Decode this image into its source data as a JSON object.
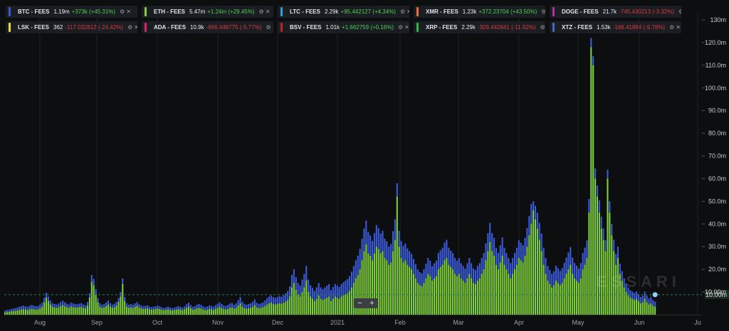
{
  "legend": [
    {
      "name": "BTC - FEES",
      "value": "1.19m",
      "change": "+373k",
      "pct": "(+45.31%)",
      "dir": "up",
      "color": "#3b5bdb"
    },
    {
      "name": "ETH - FEES",
      "value": "5.47m",
      "change": "+1.24m",
      "pct": "(+29.45%)",
      "dir": "up",
      "color": "#7fd13b"
    },
    {
      "name": "LTC - FEES",
      "value": "2.29k",
      "change": "+95.442127",
      "pct": "(+4.34%)",
      "dir": "up",
      "color": "#2aa1d9"
    },
    {
      "name": "XMR - FEES",
      "value": "1.23k",
      "change": "+372.23704",
      "pct": "(+43.50%)",
      "dir": "up",
      "color": "#e8703a"
    },
    {
      "name": "DOGE - FEES",
      "value": "21.7k",
      "change": "-745.430213",
      "pct": "(-3.32%)",
      "dir": "down",
      "color": "#b0309c"
    },
    {
      "name": "LSK - FEES",
      "value": "362",
      "change": "-117.032812",
      "pct": "(-24.42%)",
      "dir": "down",
      "color": "#e8e02a"
    },
    {
      "name": "ADA - FEES",
      "value": "10.9k",
      "change": "-666.448775",
      "pct": "(-5.77%)",
      "dir": "down",
      "color": "#d8286c"
    },
    {
      "name": "BSV - FEES",
      "value": "1.01k",
      "change": "+1.662759",
      "pct": "(+0.16%)",
      "dir": "up",
      "color": "#c4202c"
    },
    {
      "name": "XRP - FEES",
      "value": "2.29k",
      "change": "-309.442841",
      "pct": "(-11.92%)",
      "dir": "down",
      "color": "#2fb84a"
    },
    {
      "name": "XTZ - FEES",
      "value": "1.53k",
      "change": "-166.41894",
      "pct": "(-9.78%)",
      "dir": "down",
      "color": "#4a64c8"
    }
  ],
  "legend_icons": [
    "gear-icon",
    "close-icon"
  ],
  "zoom": {
    "minus": "−",
    "plus": "+"
  },
  "watermark": "ESSARI",
  "colors": {
    "background": "#0c0e10",
    "eth": "#7fd13b",
    "btc": "#3b5bdb",
    "grid": "#1c2026",
    "ref_line": "#2e7d5a",
    "marker": "#8fd3f0"
  },
  "chart_data": {
    "type": "bar",
    "stacked": true,
    "x_start": "Jul 2020",
    "x_ticks": [
      "Aug",
      "Sep",
      "Oct",
      "Nov",
      "Dec",
      "2021",
      "Feb",
      "Mar",
      "Apr",
      "May",
      "Jun",
      "Ju"
    ],
    "y_ticks": [
      "10.00m",
      "20.0m",
      "30.0m",
      "40.0m",
      "50.0m",
      "60.0m",
      "70.0m",
      "80.0m",
      "90.0m",
      "100.0m",
      "110.0m",
      "120.0m",
      "130m"
    ],
    "ylim": [
      0,
      130
    ],
    "y_unit": "m",
    "reference_line": 8.8,
    "reference_label": "10.00m",
    "series": [
      {
        "name": "ETH - FEES",
        "color": "#7fd13b",
        "values": [
          1.0,
          1.2,
          1.3,
          1.5,
          1.6,
          1.7,
          1.9,
          2.1,
          2.3,
          2.4,
          2.2,
          2.0,
          2.4,
          2.6,
          2.4,
          2.2,
          2.3,
          2.8,
          3.5,
          5.5,
          7.5,
          6.0,
          4.5,
          3.5,
          3.2,
          3.0,
          3.3,
          3.8,
          4.2,
          3.7,
          3.3,
          3.0,
          3.6,
          3.4,
          3.2,
          3.1,
          3.3,
          3.5,
          3.0,
          2.8,
          4.0,
          7.5,
          14.5,
          13.0,
          9.0,
          5.5,
          3.5,
          3.0,
          3.2,
          3.8,
          4.5,
          3.5,
          3.0,
          3.3,
          4.0,
          5.5,
          8.0,
          13.5,
          6.0,
          3.5,
          3.0,
          3.2,
          3.0,
          3.5,
          4.0,
          3.2,
          2.8,
          2.5,
          2.6,
          2.8,
          2.4,
          2.2,
          2.3,
          2.5,
          2.7,
          2.5,
          2.1,
          2.0,
          2.2,
          2.4,
          2.1,
          1.9,
          2.0,
          2.2,
          2.5,
          2.3,
          2.0,
          2.4,
          3.0,
          3.5,
          2.8,
          2.2,
          2.4,
          2.8,
          3.0,
          2.7,
          2.3,
          2.0,
          2.2,
          2.5,
          2.4,
          2.1,
          2.6,
          3.0,
          3.5,
          2.9,
          2.5,
          2.3,
          2.6,
          3.0,
          3.2,
          2.6,
          3.0,
          4.0,
          5.0,
          3.5,
          2.9,
          2.6,
          2.8,
          3.0,
          3.5,
          4.2,
          3.2,
          2.8,
          3.0,
          3.3,
          3.8,
          4.5,
          5.0,
          5.3,
          4.8,
          4.5,
          4.8,
          5.0,
          4.8,
          5.2,
          5.8,
          6.5,
          8.0,
          12.0,
          14.0,
          11.0,
          9.0,
          8.0,
          10.0,
          12.0,
          15.0,
          10.0,
          8.0,
          7.0,
          6.0,
          7.0,
          8.5,
          7.0,
          6.5,
          7.0,
          7.5,
          8.0,
          6.0,
          7.0,
          8.0,
          7.5,
          7.0,
          8.0,
          8.5,
          9.0,
          9.5,
          10.5,
          12.0,
          14.0,
          16.0,
          17.5,
          20.0,
          24.0,
          28.0,
          31.0,
          27.0,
          26.0,
          24.0,
          27.0,
          30.0,
          29.0,
          27.0,
          28.0,
          25.0,
          24.0,
          22.0,
          23.0,
          28.0,
          33.0,
          52.0,
          30.0,
          25.0,
          23.0,
          24.0,
          22.0,
          21.0,
          20.0,
          18.0,
          16.0,
          14.0,
          13.0,
          12.5,
          14.0,
          16.0,
          18.0,
          17.0,
          15.0,
          16.0,
          17.0,
          20.0,
          21.0,
          22.0,
          24.0,
          25.0,
          22.0,
          21.0,
          20.0,
          18.0,
          17.0,
          18.0,
          16.0,
          15.0,
          14.0,
          16.0,
          18.0,
          16.0,
          14.0,
          13.5,
          15.0,
          16.0,
          18.0,
          20.0,
          24.0,
          28.0,
          32.0,
          28.0,
          26.0,
          22.0,
          20.0,
          23.0,
          26.0,
          22.0,
          20.0,
          18.0,
          16.0,
          18.0,
          20.0,
          22.0,
          25.0,
          24.0,
          23.0,
          26.0,
          30.0,
          35.0,
          40.0,
          46.0,
          42.0,
          38.0,
          33.0,
          28.0,
          22.0,
          18.0,
          15.0,
          13.5,
          12.0,
          13.0,
          15.0,
          14.0,
          13.0,
          14.0,
          16.0,
          18.0,
          20.0,
          22.0,
          18.0,
          16.0,
          15.0,
          14.0,
          16.0,
          20.0,
          22.0,
          25.0,
          45.0,
          118.0,
          110.0,
          60.0,
          52.0,
          45.0,
          38.0,
          33.0,
          28.0,
          60.0,
          45.0,
          35.0,
          28.0,
          22.0,
          25.0,
          18.0,
          15.0,
          12.0,
          10.0,
          8.5,
          7.5,
          7.0,
          6.5,
          7.0,
          6.0,
          5.0,
          5.5,
          7.0,
          5.5,
          4.5,
          5.0,
          4.0,
          3.5
        ]
      },
      {
        "name": "BTC - FEES",
        "color": "#3b5bdb",
        "values": [
          0.8,
          0.9,
          0.9,
          1.0,
          1.1,
          1.2,
          1.3,
          1.4,
          1.5,
          1.6,
          1.5,
          1.4,
          1.6,
          1.7,
          1.6,
          1.5,
          1.5,
          1.7,
          1.8,
          2.0,
          2.2,
          2.0,
          1.8,
          1.6,
          1.5,
          1.5,
          1.6,
          1.8,
          2.0,
          1.8,
          1.6,
          1.5,
          1.7,
          1.6,
          1.5,
          1.5,
          1.6,
          1.6,
          1.5,
          1.4,
          1.6,
          2.0,
          3.0,
          2.8,
          2.2,
          1.8,
          1.5,
          1.4,
          1.5,
          1.6,
          1.8,
          1.6,
          1.4,
          1.5,
          1.6,
          1.8,
          2.0,
          2.5,
          1.8,
          1.5,
          1.4,
          1.5,
          1.4,
          1.5,
          1.6,
          1.4,
          1.3,
          1.2,
          1.3,
          1.3,
          1.2,
          1.1,
          1.2,
          1.2,
          1.3,
          1.2,
          1.1,
          1.0,
          1.1,
          1.2,
          1.1,
          1.0,
          1.1,
          1.2,
          1.3,
          1.2,
          1.1,
          1.3,
          1.6,
          1.8,
          1.5,
          1.3,
          1.4,
          1.6,
          1.7,
          1.6,
          1.4,
          1.3,
          1.4,
          1.5,
          1.5,
          1.4,
          1.6,
          1.8,
          2.0,
          1.8,
          1.6,
          1.5,
          1.7,
          1.9,
          2.0,
          1.8,
          2.0,
          2.4,
          2.8,
          2.2,
          1.9,
          1.8,
          1.9,
          2.0,
          2.2,
          2.6,
          2.1,
          1.9,
          2.0,
          2.2,
          2.5,
          2.8,
          3.0,
          3.2,
          3.0,
          2.9,
          3.0,
          3.2,
          3.1,
          3.3,
          3.6,
          4.0,
          4.5,
          5.5,
          6.0,
          5.5,
          5.0,
          4.8,
          5.5,
          6.0,
          6.5,
          5.5,
          5.0,
          4.8,
          4.5,
          5.0,
          5.5,
          5.0,
          4.8,
          5.0,
          5.3,
          5.5,
          4.8,
          5.2,
          5.5,
          5.3,
          5.2,
          5.5,
          5.8,
          6.0,
          6.2,
          6.5,
          7.0,
          7.5,
          8.0,
          8.5,
          9.0,
          9.5,
          10.0,
          10.5,
          9.5,
          9.0,
          8.5,
          9.0,
          9.5,
          9.2,
          8.8,
          9.0,
          8.5,
          8.3,
          8.0,
          8.2,
          8.8,
          9.0,
          6.0,
          7.0,
          7.5,
          7.3,
          7.4,
          7.2,
          7.0,
          6.8,
          6.5,
          6.3,
          6.0,
          5.8,
          5.7,
          6.0,
          6.5,
          7.0,
          6.8,
          6.4,
          6.6,
          6.8,
          7.2,
          7.4,
          7.5,
          7.8,
          8.0,
          7.5,
          7.3,
          7.2,
          7.0,
          6.8,
          7.0,
          6.7,
          6.5,
          6.3,
          6.7,
          7.0,
          6.7,
          6.4,
          6.2,
          6.5,
          6.7,
          7.0,
          7.2,
          7.5,
          8.0,
          8.5,
          8.0,
          7.8,
          7.4,
          7.2,
          7.6,
          8.0,
          7.5,
          7.2,
          7.0,
          6.8,
          7.0,
          7.2,
          7.5,
          7.8,
          7.7,
          7.6,
          7.9,
          8.2,
          8.5,
          8.8,
          4.0,
          6.0,
          7.0,
          7.5,
          7.8,
          7.5,
          7.0,
          6.5,
          6.2,
          6.0,
          6.2,
          6.6,
          6.5,
          6.3,
          6.5,
          6.8,
          7.2,
          7.5,
          7.8,
          7.2,
          6.8,
          6.6,
          6.4,
          6.8,
          7.2,
          7.5,
          7.8,
          6.0,
          4.0,
          4.0,
          4.5,
          5.0,
          5.5,
          5.2,
          5.0,
          4.8,
          4.0,
          5.0,
          5.0,
          5.0,
          4.8,
          5.0,
          4.5,
          4.2,
          4.0,
          3.8,
          3.5,
          3.3,
          3.2,
          3.1,
          3.2,
          3.0,
          2.8,
          2.9,
          3.2,
          2.9,
          2.6,
          2.8,
          2.5,
          2.3
        ]
      }
    ]
  }
}
